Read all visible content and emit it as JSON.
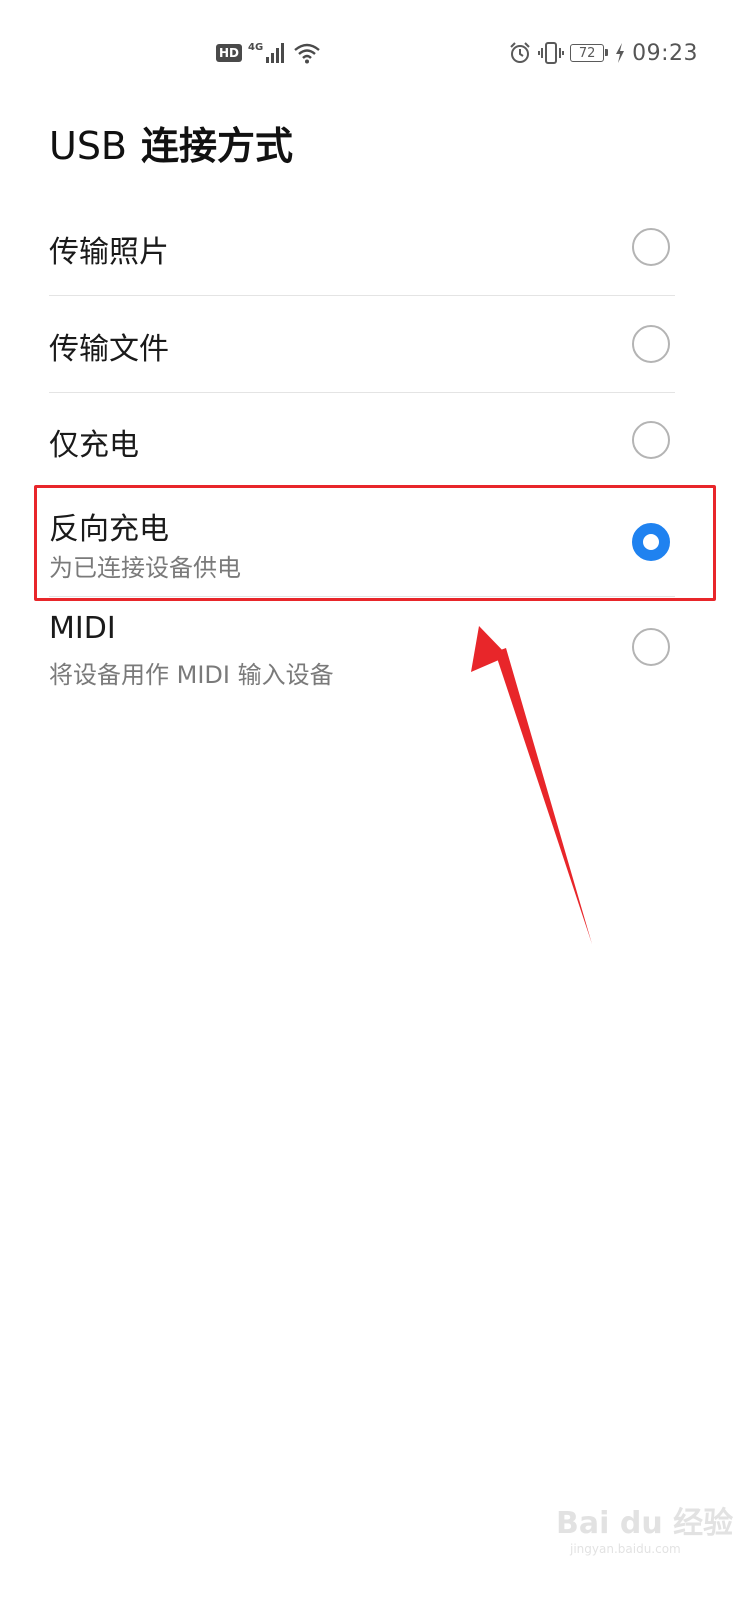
{
  "status_bar": {
    "hd_label": "HD",
    "network_label": "4G",
    "battery_level": "72",
    "time": "09:23",
    "icons": [
      "hd-icon",
      "signal-icon",
      "wifi-icon",
      "alarm-icon",
      "vibrate-icon",
      "battery-icon",
      "charging-icon"
    ]
  },
  "title": {
    "prefix": "USB",
    "main": "连接方式"
  },
  "options": [
    {
      "label": "传输照片",
      "sublabel": "",
      "selected": false
    },
    {
      "label": "传输文件",
      "sublabel": "",
      "selected": false
    },
    {
      "label": "仅充电",
      "sublabel": "",
      "selected": false
    },
    {
      "label": "反向充电",
      "sublabel": "为已连接设备供电",
      "selected": true
    },
    {
      "label": "MIDI",
      "sublabel": "将设备用作 MIDI 输入设备",
      "selected": false
    }
  ],
  "annotation": {
    "highlight_color": "#e8262a",
    "arrow_color": "#e8262a",
    "highlighted_option": "反向充电"
  },
  "colors": {
    "accent": "#1f82f0",
    "text_primary": "#1a1a1a",
    "text_secondary": "#7a7a7a"
  },
  "watermark": {
    "main": "Bai du 经验",
    "sub": "jingyan.baidu.com"
  }
}
